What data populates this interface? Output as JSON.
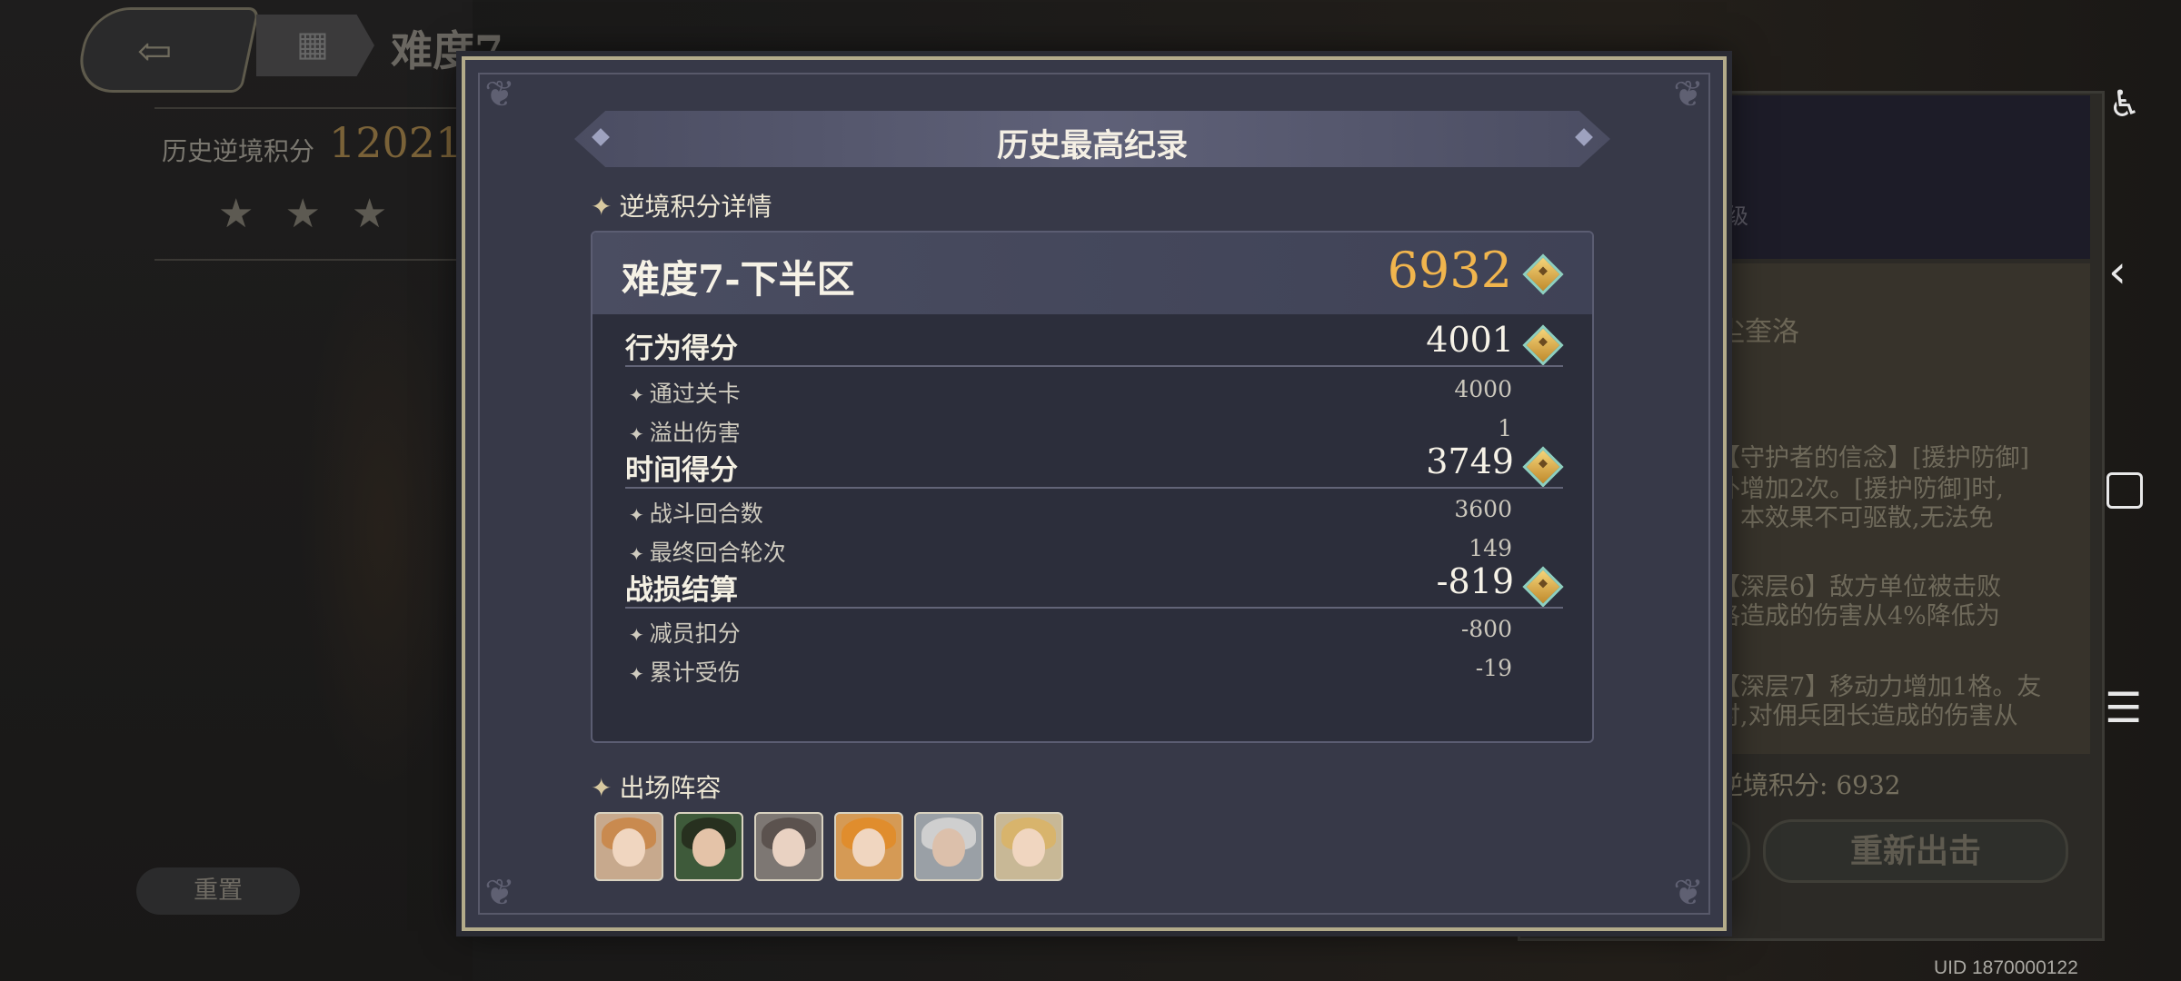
{
  "background": {
    "difficulty_title": "难度7",
    "history_score_label": "历史逆境积分",
    "history_score_value": "12021",
    "stars": "★★★",
    "reset_label": "重置",
    "level_text": "级",
    "name_text": "尘奎洛",
    "desc_lines": [
      "【守护者的信念】[援护防御]",
      "外增加2次。[援护防御]时,",
      "。本效果不可驱散,无法免",
      "【深层6】敌方单位被击败",
      "洛造成的伤害从4%降低为",
      "【深层7】移动力增加1格。友",
      "时,对佣兵团长造成的伤害从"
    ],
    "total_score_text": "逆境积分: 6932",
    "redeploy_label": "重新出击",
    "uid": "UID 1870000122"
  },
  "icons": {
    "back": "back-arrow-icon",
    "menu": "grid-menu-icon",
    "gem": "score-gem-icon",
    "sys_accessibility": "accessibility-icon",
    "sys_back": "chevron-left-icon",
    "sys_home": "square-home-icon",
    "sys_menu": "hamburger-menu-icon"
  },
  "modal": {
    "title": "历史最高纪录",
    "details_label": "逆境积分详情",
    "difficulty_label": "难度7-下半区",
    "total_score": "6932",
    "groups": [
      {
        "title": "行为得分",
        "value": "4001",
        "items": [
          {
            "label": "通过关卡",
            "value": "4000"
          },
          {
            "label": "溢出伤害",
            "value": "1"
          }
        ]
      },
      {
        "title": "时间得分",
        "value": "3749",
        "items": [
          {
            "label": "战斗回合数",
            "value": "3600"
          },
          {
            "label": "最终回合轮次",
            "value": "149"
          }
        ]
      },
      {
        "title": "战损结算",
        "value": "-819",
        "items": [
          {
            "label": "减员扣分",
            "value": "-800"
          },
          {
            "label": "累计受伤",
            "value": "-19"
          }
        ]
      }
    ],
    "lineup_label": "出场阵容"
  },
  "colors": {
    "accent_gold": "#f1b54d",
    "modal_bg": "#373948",
    "modal_border": "#b3ab8a"
  }
}
